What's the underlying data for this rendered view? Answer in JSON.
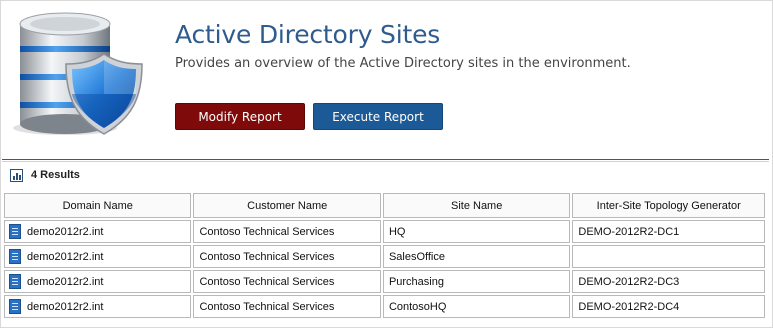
{
  "header": {
    "title": "Active Directory Sites",
    "subtitle": "Provides an overview of the Active Directory sites in the environment.",
    "logo_icon": "database-shield-icon"
  },
  "actions": {
    "modify_label": "Modify Report",
    "execute_label": "Execute Report",
    "modify_color": "#7f0a0a",
    "execute_color": "#1b5a96"
  },
  "results": {
    "icon": "bar-chart-icon",
    "count_label": "4 Results"
  },
  "table": {
    "columns": [
      "Domain Name",
      "Customer Name",
      "Site Name",
      "Inter-Site Topology Generator"
    ],
    "row_icon": "server-icon",
    "rows": [
      [
        "demo2012r2.int",
        "Contoso Technical Services",
        "HQ",
        "DEMO-2012R2-DC1"
      ],
      [
        "demo2012r2.int",
        "Contoso Technical Services",
        "SalesOffice",
        ""
      ],
      [
        "demo2012r2.int",
        "Contoso Technical Services",
        "Purchasing",
        "DEMO-2012R2-DC3"
      ],
      [
        "demo2012r2.int",
        "Contoso Technical Services",
        "ContosoHQ",
        "DEMO-2012R2-DC4"
      ]
    ]
  }
}
